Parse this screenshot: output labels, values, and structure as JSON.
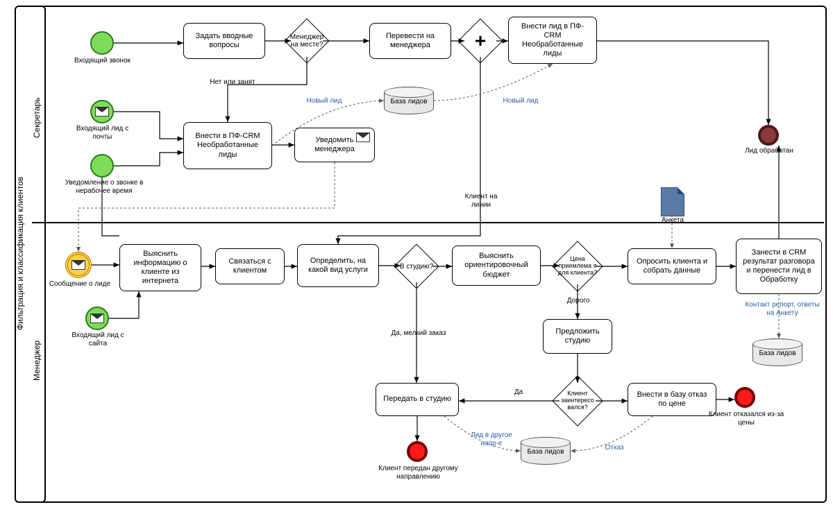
{
  "pool_title": "Фильтрация и классификация клиентов",
  "lanes": {
    "secretary": "Секретарь",
    "manager": "Менеджер"
  },
  "events": {
    "call_in": "Входящий звонок",
    "mail_in": "Входящий лид с почты",
    "offhours": "Уведомление о звонке в нерабочее время",
    "lead_msg": "Сообщение о лиде",
    "site_lead": "Входящий лид с сайта",
    "lead_done": "Лид обработан",
    "to_other": "Клиент передан другому направлению",
    "price_decline": "Клиент отказался из-за цены"
  },
  "tasks": {
    "ask_intro": "Задать вводные вопросы",
    "transfer_mgr": "Перевести на менеджера",
    "to_crm_unproc": "Внести лид в ПФ-CRM Необработанные лиды",
    "add_crm": "Внести в ПФ-CRM Необработанные лиды",
    "notify_mgr": "Уведомить менеджера",
    "find_info": "Выяснить информацию о клиенте из интернета",
    "contact": "Связаться с клиентом",
    "det_service": "Определить, на какой вид услуги",
    "budget": "Выяснить ориентировочный бюджет",
    "offer_studio": "Предложить студию",
    "survey": "Опросить клиента и собрать данные",
    "to_crm_result": "Занести в CRM результат разговора и перенести лид в Обработку",
    "to_studio": "Передать в студию",
    "reject_db": "Внести в базу отказ по цене"
  },
  "gateways": {
    "mgr_here": "Менеджер на месте?",
    "to_studio_q": "В студию?",
    "price_ok": "Цена приемлема я для клиента?",
    "interested": "Клиент заинтересо вался?"
  },
  "data": {
    "leads_db": "База лидов",
    "survey_form": "Анкета",
    "contact_report": "Контакт репорт, ответы на Анкету"
  },
  "edge_labels": {
    "no_busy": "Нет или занят",
    "new_lead": "Новый лид",
    "client_line": "Клиент на линии",
    "small_order": "Да, мелкий заказ",
    "expensive": "Дорого",
    "yes": "Да",
    "lead_other": "Лид в другое напр-е",
    "refuse": "Отказ"
  }
}
